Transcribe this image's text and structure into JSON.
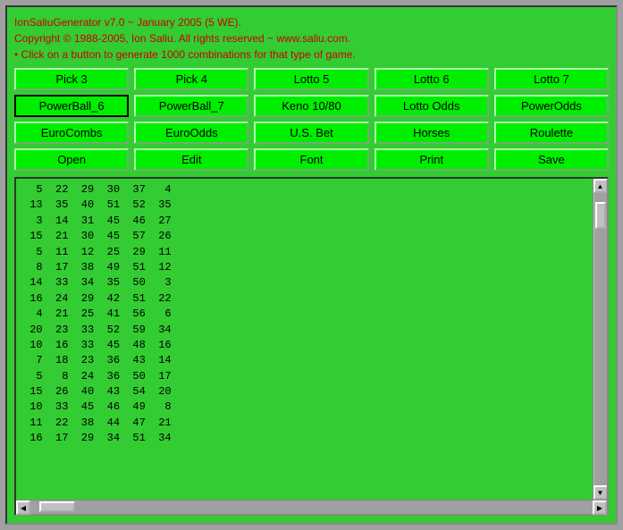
{
  "header": {
    "line1": "IonSaliuGenerator v7.0 ~ January 2005 (5 WE).",
    "line2": "Copyright © 1988-2005, Ion Saliu. All rights reserved ~ www.saliu.com.",
    "line3": "• Click on a button to generate 1000 combinations for that type of game."
  },
  "buttons_row1": [
    {
      "id": "pick3",
      "label": "Pick 3"
    },
    {
      "id": "pick4",
      "label": "Pick 4"
    },
    {
      "id": "lotto5",
      "label": "Lotto 5"
    },
    {
      "id": "lotto6",
      "label": "Lotto 6"
    },
    {
      "id": "lotto7",
      "label": "Lotto 7"
    }
  ],
  "buttons_row2": [
    {
      "id": "powerball6",
      "label": "PowerBall_6",
      "selected": true
    },
    {
      "id": "powerball7",
      "label": "PowerBall_7"
    },
    {
      "id": "keno",
      "label": "Keno 10/80"
    },
    {
      "id": "lottoodds",
      "label": "Lotto Odds"
    },
    {
      "id": "powerodds",
      "label": "PowerOdds"
    }
  ],
  "buttons_row3": [
    {
      "id": "eurocombos",
      "label": "EuroCombs"
    },
    {
      "id": "eurocodds",
      "label": "EuroOdds"
    },
    {
      "id": "usbet",
      "label": "U.S. Bet"
    },
    {
      "id": "horses",
      "label": "Horses"
    },
    {
      "id": "roulette",
      "label": "Roulette"
    }
  ],
  "buttons_row4": [
    {
      "id": "open",
      "label": "Open"
    },
    {
      "id": "edit",
      "label": "Edit"
    },
    {
      "id": "font",
      "label": "Font"
    },
    {
      "id": "print",
      "label": "Print"
    },
    {
      "id": "save",
      "label": "Save"
    }
  ],
  "output": {
    "content": "  5  22  29  30  37   4\n 13  35  40  51  52  35\n  3  14  31  45  46  27\n 15  21  30  45  57  26\n  5  11  12  25  29  11\n  8  17  38  49  51  12\n 14  33  34  35  50   3\n 16  24  29  42  51  22\n  4  21  25  41  56   6\n 20  23  33  52  59  34\n 10  16  33  45  48  16\n  7  18  23  36  43  14\n  5   8  24  36  50  17\n 15  26  40  43  54  20\n 10  33  45  46  49   8\n 11  22  38  44  47  21\n 16  17  29  34  51  34"
  }
}
